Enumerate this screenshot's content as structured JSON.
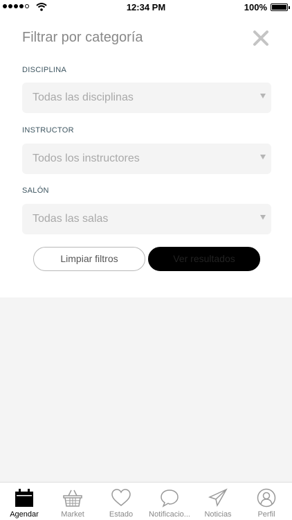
{
  "status_bar": {
    "time": "12:34 PM",
    "battery": "100%"
  },
  "filter": {
    "title": "Filtrar por categoría",
    "fields": [
      {
        "label": "DISCIPLINA",
        "value": "Todas las disciplinas"
      },
      {
        "label": "INSTRUCTOR",
        "value": "Todos los instructores"
      },
      {
        "label": "SALÓN",
        "value": "Todas las salas"
      }
    ],
    "clear_label": "Limpiar filtros",
    "results_label": "Ver resultados"
  },
  "tabs": [
    {
      "label": "Agendar",
      "icon": "calendar-icon",
      "active": true
    },
    {
      "label": "Market",
      "icon": "basket-icon"
    },
    {
      "label": "Estado",
      "icon": "heart-icon"
    },
    {
      "label": "Notificacio...",
      "icon": "chat-bubble-icon"
    },
    {
      "label": "Noticias",
      "icon": "paper-plane-icon"
    },
    {
      "label": "Perfil",
      "icon": "user-icon"
    }
  ]
}
